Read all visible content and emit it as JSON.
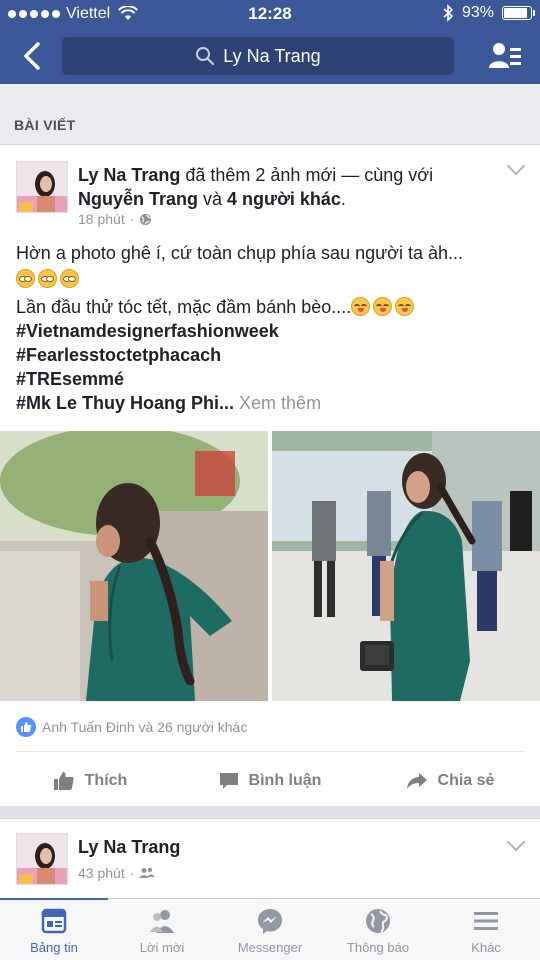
{
  "status": {
    "carrier": "Viettel",
    "time": "12:28",
    "battery": "93%",
    "battery_level": 0.93
  },
  "nav": {
    "search_text": "Ly Na Trang"
  },
  "section_label": "BÀI VIẾT",
  "post": {
    "author": "Ly Na Trang",
    "action_text": " đã thêm 2 ảnh mới — cùng với ",
    "tagged": "Nguyễn Trang",
    "and_text": " và ",
    "others": "4 người khác",
    "period": ".",
    "time": "18 phút",
    "line1": "Hờn a photo ghê í, cứ toàn chụp phía sau người ta àh...",
    "line2": "Lần đầu thử tóc tết, mặc đầm bánh bèo....",
    "hashtags": [
      "#Vietnamdesignerfashionweek",
      "#Fearlesstoctetphacach",
      "#TREsemmé"
    ],
    "last_tag": "#Mk Le Thuy Hoang Phi...",
    "see_more": " Xem thêm",
    "likes_text": "Anh Tuấn Đinh và 26 người khác",
    "actions": {
      "like": "Thích",
      "comment": "Bình luận",
      "share": "Chia sẻ"
    }
  },
  "post2": {
    "author": "Ly Na Trang",
    "time": "43 phút"
  },
  "tabs": [
    "Bảng tin",
    "Lời mời",
    "Messenger",
    "Thông báo",
    "Khác"
  ],
  "colors": {
    "brand": "#3b5998",
    "active_tab": "#4267b2",
    "dress": "#1f6b63"
  }
}
